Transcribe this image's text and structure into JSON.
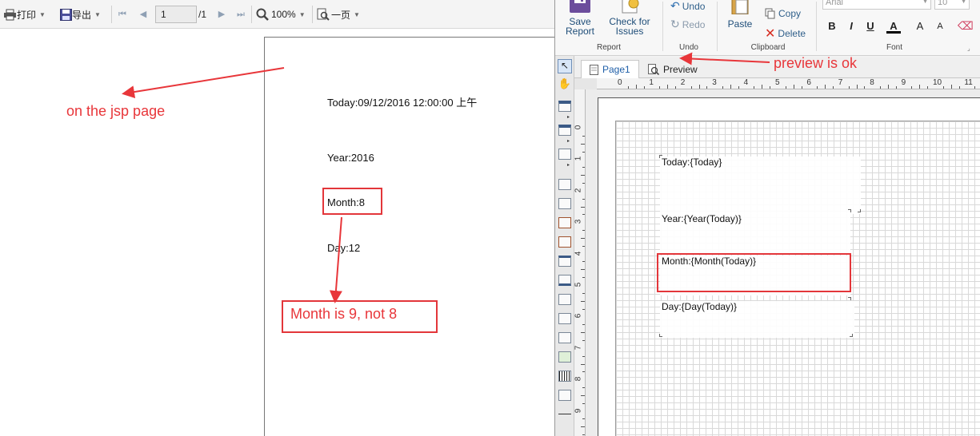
{
  "left_toolbar": {
    "print_label": "打印",
    "export_label": "导出",
    "page_value": "1",
    "page_total": "/1",
    "zoom_value": "100%",
    "view_mode": "一页"
  },
  "jsp_page": {
    "today_text": "Today:09/12/2016 12:00:00 上午",
    "year_text": "Year:2016",
    "month_text": "Month:8",
    "day_text": "Day:12"
  },
  "annotations": {
    "jsp_note": "on the jsp page",
    "month_note": "Month is 9, not 8",
    "preview_note": "preview is ok",
    "color": "#e8363a"
  },
  "ribbon": {
    "save_label_1": "Save",
    "save_label_2": "Report",
    "check_label_1": "Check for",
    "check_label_2": "Issues",
    "undo_label": "Undo",
    "redo_label": "Redo",
    "paste_label": "Paste",
    "copy_label": "Copy",
    "delete_label": "Delete",
    "font_name": "Arial",
    "font_size": "10",
    "bold_label": "B",
    "italic_label": "I",
    "underline_label": "U",
    "font_color_label": "A",
    "grow_label": "A",
    "shrink_label": "A",
    "group_report": "Report",
    "group_undo": "Undo",
    "group_clipboard": "Clipboard",
    "group_font": "Font"
  },
  "designer_tabs": [
    {
      "label": "Page1",
      "active": true
    },
    {
      "label": "Preview",
      "active": false
    }
  ],
  "ruler_h_ticks": [
    "0",
    "1",
    "2",
    "3",
    "4",
    "5",
    "6",
    "7",
    "8",
    "9",
    "10",
    "11"
  ],
  "ruler_v_ticks": [
    "0",
    "1",
    "2",
    "3",
    "4",
    "5",
    "6",
    "7",
    "8",
    "9"
  ],
  "design_fields": {
    "today": "Today:{Today}",
    "year": "Year:{Year(Today)}",
    "month": "Month:{Month(Today)}",
    "day": "Day:{Day(Today)}"
  }
}
